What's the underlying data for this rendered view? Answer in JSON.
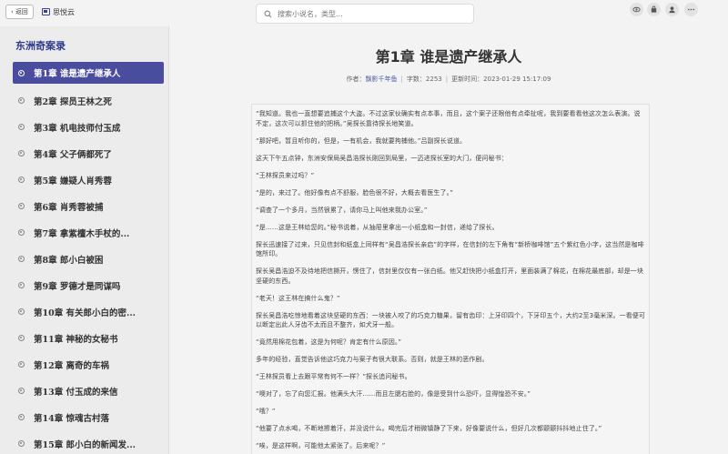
{
  "topbar": {
    "back_label": "返回",
    "brand_name": "思悦云",
    "search_placeholder": "搜索小说名，类型..."
  },
  "sidebar": {
    "book_title": "东洲奇案录",
    "chapters": [
      {
        "label": "第1章  谁是遗产继承人",
        "active": true
      },
      {
        "label": "第2章  探员王林之死"
      },
      {
        "label": "第3章  机电技师付玉成"
      },
      {
        "label": "第4章  父子俩都死了"
      },
      {
        "label": "第5章  嫌疑人肖秀蓉"
      },
      {
        "label": "第6章  肖秀蓉被捕"
      },
      {
        "label": "第7章  拿紫檀木手杖的..."
      },
      {
        "label": "第8章  郎小白被困"
      },
      {
        "label": "第9章  罗德才是同谋吗"
      },
      {
        "label": "第10章  有关郎小白的密..."
      },
      {
        "label": "第11章  神秘的女秘书"
      },
      {
        "label": "第12章  离奇的车祸"
      },
      {
        "label": "第13章  付玉成的来信"
      },
      {
        "label": "第14章  惊魂古村落"
      },
      {
        "label": "第15章  郎小白的新闻发..."
      }
    ]
  },
  "reader": {
    "title": "第1章 谁是遗产继承人",
    "author_label": "作者：",
    "author": "飘影千年鱼",
    "word_count": "字数：2253",
    "updated": "更新时间：2023-01-29 15:17:09",
    "paragraphs": [
      "“我知道。我也一直想要追捕这个大盗。不过这家伙确实有点本事，而且，这个案子还限他有点牵扯呢，我到要看看他这次怎么表演。说不定，这次可以抓住他的把柄。”吴探长靠待探长地笑道。",
      "“那好吧，暂且听你的，但是，一有机会，我就要拘捕他。”吕副探长说道。",
      "这天下午五点钟，东洲安保局吴昌浩探长刚回到局里，一迈进探长室的大门，便问秘书：",
      "“王林探员来过吗？”",
      "“是的，来过了。他好像有点不舒服，脸色很不好，大概去看医生了。”",
      "“调查了一个多月，当然很累了，请你马上叫他来我办公室。”",
      "“是……这是王林给您的。”秘书说着，从抽屉里拿出一小纸盒和一封信，递给了探长。",
      "探长迅速接了过来，只见信封和纸盒上同样有“吴昌浩探长亲启”的字样，在信封的左下角有“新桥咖啡馆”五个紫红色小字，这当然是咖啡馆所印。",
      "探长吴昌浩迫不及待地把信撕开，愣住了，信封里仅仅有一张白纸。他又赶快把小纸盒打开，里面装满了棉花，在棉花最底部，却是一块坚硬的东西。",
      "“老天！这王林在搞什么鬼？”",
      "探长吴昌浩吃惊地看着这块坚硬的东西：一块被人咬了的巧克力糖果，留有齿印：上牙印四个，下牙印五个，大约2至3毫米深。一看便可以断定出此人牙齿不太而且不整齐，如犬牙一般。",
      "“竟然用棉花包着，这是为何呢？肯定有什么原因。”",
      "多年的经验，直觉告诉他这巧克力与案子有很大联系。否则，就是王林的恶作剧。",
      "“王林探员看上去跟平常有何不一样？”探长追问秘书。",
      "“噢对了，忘了向您汇报。他满头大汗……而且左腮右脸的，像是受到什么恐吓，显得惶恐不安。”",
      "“哦？”",
      "“他要了点水喝，不断地擦着汗，并没说什么。喝完后才稍微镇静了下来，好像要说什么，但好几次都颤颤抖抖地止住了。”",
      "“唉，是这样啊，可能他太紧张了。后来呢？”"
    ]
  }
}
